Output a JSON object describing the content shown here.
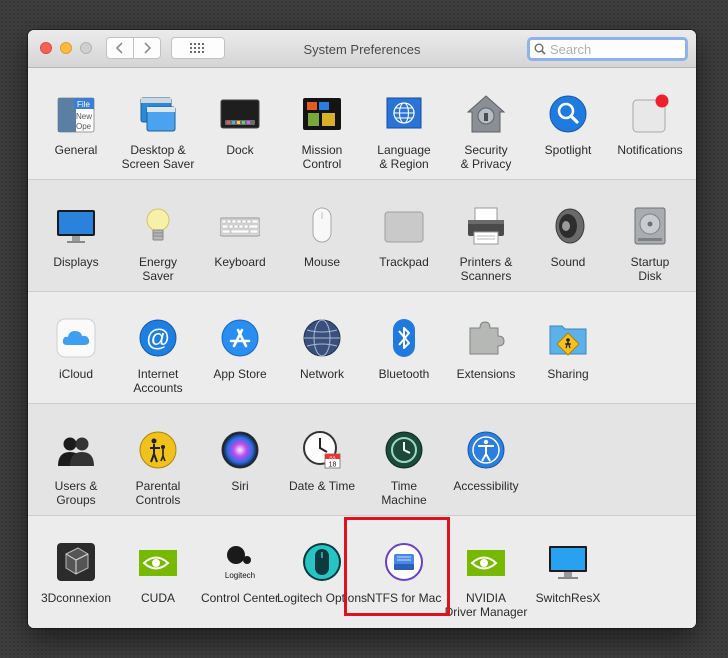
{
  "window": {
    "title": "System Preferences",
    "search_placeholder": "Search"
  },
  "rows": [
    [
      "General",
      "Desktop &\nScreen Saver",
      "Dock",
      "Mission\nControl",
      "Language\n& Region",
      "Security\n& Privacy",
      "Spotlight",
      "Notifications"
    ],
    [
      "Displays",
      "Energy\nSaver",
      "Keyboard",
      "Mouse",
      "Trackpad",
      "Printers &\nScanners",
      "Sound",
      "Startup\nDisk"
    ],
    [
      "iCloud",
      "Internet\nAccounts",
      "App Store",
      "Network",
      "Bluetooth",
      "Extensions",
      "Sharing"
    ],
    [
      "Users &\nGroups",
      "Parental\nControls",
      "Siri",
      "Date & Time",
      "Time\nMachine",
      "Accessibility"
    ],
    [
      "3Dconnexion",
      "CUDA",
      "Control Center",
      "Logitech Options",
      "NTFS for Mac",
      "NVIDIA\nDriver Manager",
      "SwitchResX"
    ]
  ],
  "panes": {
    "general": "General",
    "desktop": "Desktop &\nScreen Saver",
    "dock": "Dock",
    "mission": "Mission\nControl",
    "language": "Language\n& Region",
    "security": "Security\n& Privacy",
    "spotlight": "Spotlight",
    "notifications": "Notifications",
    "displays": "Displays",
    "energy": "Energy\nSaver",
    "keyboard": "Keyboard",
    "mouse": "Mouse",
    "trackpad": "Trackpad",
    "printers": "Printers &\nScanners",
    "sound": "Sound",
    "startup": "Startup\nDisk",
    "icloud": "iCloud",
    "internet": "Internet\nAccounts",
    "appstore": "App Store",
    "network": "Network",
    "bluetooth": "Bluetooth",
    "extensions": "Extensions",
    "sharing": "Sharing",
    "users": "Users &\nGroups",
    "parental": "Parental\nControls",
    "siri": "Siri",
    "datetime": "Date & Time",
    "timemachine": "Time\nMachine",
    "accessibility": "Accessibility",
    "threed": "3Dconnexion",
    "cuda": "CUDA",
    "controlcenter": "Control Center",
    "logitech": "Logitech Options",
    "ntfs": "NTFS for Mac",
    "nvidia": "NVIDIA\nDriver Manager",
    "switchresx": "SwitchResX"
  },
  "icon_text": {
    "general_file": "File",
    "general_new": "New",
    "general_open": "Ope",
    "logitech_brand": "Logitech",
    "calendar_month": "JUL",
    "calendar_day": "18"
  },
  "colors": {
    "highlight": "#e0101e",
    "search_focus": "#8db3ea",
    "close": "#fc605b",
    "minimize": "#fdbc40"
  }
}
